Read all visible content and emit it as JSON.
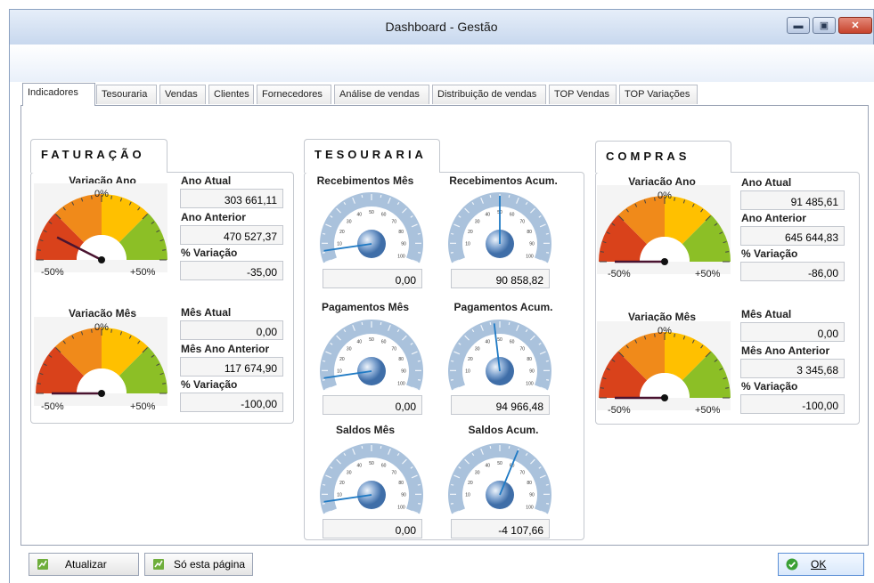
{
  "window": {
    "title": "Dashboard - Gestão",
    "minimize": "▬",
    "restore": "▣",
    "close": "✕"
  },
  "tabs": [
    "Indicadores",
    "Tesouraria",
    "Vendas",
    "Clientes",
    "Fornecedores",
    "Análise de vendas",
    "Distribuição de vendas",
    "TOP Vendas",
    "TOP Variações"
  ],
  "faturacao": {
    "title": "FATURAÇÃO",
    "gauge1": {
      "title": "Variação Ano",
      "zero": "0%",
      "min": "-50%",
      "max": "+50%",
      "value_pct": -35
    },
    "gauge2": {
      "title": "Variação Mês",
      "zero": "0%",
      "min": "-50%",
      "max": "+50%",
      "value_pct": -100
    },
    "ano_atual_label": "Ano Atual",
    "ano_atual": "303 661,11",
    "ano_anterior_label": "Ano Anterior",
    "ano_anterior": "470 527,37",
    "var_ano_label": "% Variação",
    "var_ano": "-35,00",
    "mes_atual_label": "Mês Atual",
    "mes_atual": "0,00",
    "mes_ano_anterior_label": "Mês Ano Anterior",
    "mes_ano_anterior": "117 674,90",
    "var_mes_label": "% Variação",
    "var_mes": "-100,00"
  },
  "tesouraria": {
    "title": "TESOURARIA",
    "ticks": [
      "10",
      "20",
      "30",
      "40",
      "50",
      "60",
      "70",
      "80",
      "90",
      "100"
    ],
    "rec_mes_label": "Recebimentos Mês",
    "rec_mes": "0,00",
    "rec_acum_label": "Recebimentos Acum.",
    "rec_acum": "90 858,82",
    "pag_mes_label": "Pagamentos Mês",
    "pag_mes": "0,00",
    "pag_acum_label": "Pagamentos Acum.",
    "pag_acum": "94 966,48",
    "sal_mes_label": "Saldos Mês",
    "sal_mes": "0,00",
    "sal_acum_label": "Saldos Acum.",
    "sal_acum": "-4 107,66"
  },
  "compras": {
    "title": "COMPRAS",
    "gauge1": {
      "title": "Variação Ano",
      "zero": "0%",
      "min": "-50%",
      "max": "+50%",
      "value_pct": -86
    },
    "gauge2": {
      "title": "Variação Mês",
      "zero": "0%",
      "min": "-50%",
      "max": "+50%",
      "value_pct": -100
    },
    "ano_atual_label": "Ano Atual",
    "ano_atual": "91 485,61",
    "ano_anterior_label": "Ano Anterior",
    "ano_anterior": "645 644,83",
    "var_ano_label": "% Variação",
    "var_ano": "-86,00",
    "mes_atual_label": "Mês Atual",
    "mes_atual": "0,00",
    "mes_ano_anterior_label": "Mês Ano Anterior",
    "mes_ano_anterior": "3 345,68",
    "var_mes_label": "% Variação",
    "var_mes": "-100,00"
  },
  "buttons": {
    "atualizar": "Atualizar",
    "so_pagina": "Só esta página",
    "ok": "OK"
  },
  "colors": {
    "red": "#d9421b",
    "orange": "#f08a1a",
    "yellow": "#ffc000",
    "green": "#8cbf26",
    "needle": "#4a1430"
  }
}
